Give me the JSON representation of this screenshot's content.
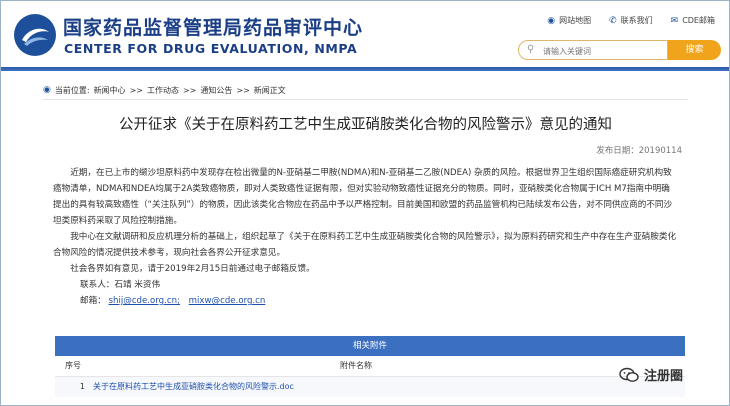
{
  "header": {
    "title_cn": "国家药品监督管理局药品审评中心",
    "title_en": "CENTER FOR DRUG EVALUATION, NMPA",
    "links": [
      {
        "label": "网站地图",
        "icon": "location-pin-icon"
      },
      {
        "label": "联系我们",
        "icon": "phone-icon"
      },
      {
        "label": "CDE邮箱",
        "icon": "mail-icon"
      }
    ],
    "search_placeholder": "请输入关键词",
    "search_button": "搜索"
  },
  "breadcrumb": {
    "prefix": "当前位置:",
    "items": [
      "新闻中心",
      "工作动态",
      "通知公告",
      "新闻正文"
    ],
    "separator": ">>"
  },
  "article": {
    "title": "公开征求《关于在原料药工艺中生成亚硝胺类化合物的风险警示》意见的通知",
    "publish_date": "发布日期：20190114",
    "paragraphs": [
      "近期，在已上市的缬沙坦原料药中发现存在检出微量的N-亚硝基二甲胺(NDMA)和N-亚硝基二乙胺(NDEA) 杂质的风险。根据世界卫生组织国际癌症研究机构致癌物清单，NDMA和NDEA均属于2A类致癌物质，即对人类致癌性证据有限，但对实验动物致癌性证据充分的物质。同时，亚硝胺类化合物属于ICH M7指南中明确提出的具有较高致癌性（“关注队列”）的物质，因此该类化合物应在药品中予以严格控制。目前美国和欧盟的药品监管机构已陆续发布公告，对不同供应商的不同沙坦类原料药采取了风险控制措施。",
      "我中心在文献调研和反应机理分析的基础上，组织起草了《关于在原料药工艺中生成亚硝胺类化合物的风险警示》，拟为原料药研究和生产中存在生产亚硝胺类化合物风险的情况提供技术参考，现向社会各界公开征求意见。",
      "社会各界如有意见，请于2019年2月15日前通过电子邮箱反馈。"
    ],
    "contacts_label": "联系人：石靖  米资伟",
    "email_label": "邮箱：",
    "emails": [
      "shij@cde.org.cn;",
      "mixw@cde.org.cn"
    ]
  },
  "attachments": {
    "heading": "相关附件",
    "col_no": "序号",
    "col_name": "附件名称",
    "rows": [
      {
        "no": "1",
        "name": "关于在原料药工艺中生成亚硝胺类化合物的风险警示.doc"
      }
    ]
  },
  "watermark": "注册圈"
}
